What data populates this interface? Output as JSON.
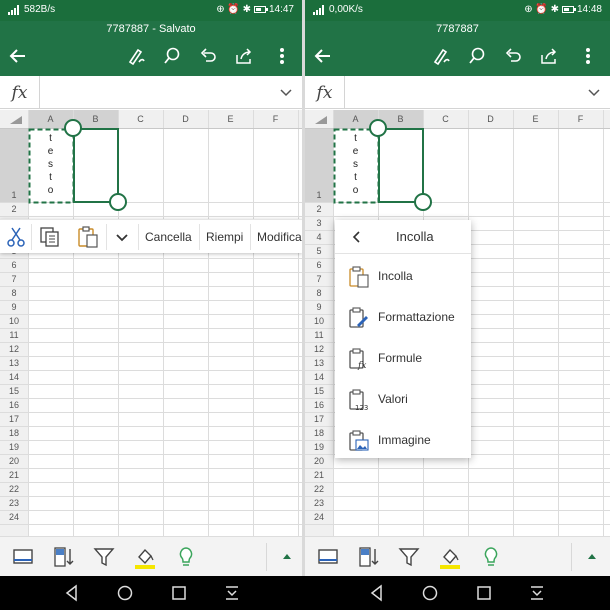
{
  "left": {
    "status": {
      "speed": "582B/s",
      "time": "14:47"
    },
    "title": "7787887 - Salvato",
    "context_toolbar": {
      "cancel_label": "Cancella",
      "fill_label": "Riempi",
      "edit_label": "Modifica"
    }
  },
  "right": {
    "status": {
      "speed": "0,00K/s",
      "time": "14:48"
    },
    "title": "7787887",
    "paste_menu": {
      "title": "Incolla",
      "items": [
        {
          "label": "Incolla",
          "icon": "paste-icon"
        },
        {
          "label": "Formattazione",
          "icon": "paste-formatting-icon"
        },
        {
          "label": "Formule",
          "icon": "paste-formulas-icon"
        },
        {
          "label": "Valori",
          "icon": "paste-values-icon"
        },
        {
          "label": "Immagine",
          "icon": "paste-picture-icon"
        }
      ]
    }
  },
  "formula_bar": {
    "fx_label": "fx"
  },
  "sheet": {
    "columns": [
      "A",
      "B",
      "C",
      "D",
      "E",
      "F"
    ],
    "rows": [
      "1",
      "2",
      "3",
      "4",
      "5",
      "6",
      "7",
      "8",
      "9",
      "10",
      "11",
      "12",
      "13",
      "14",
      "15",
      "16",
      "17",
      "18",
      "19",
      "20",
      "21",
      "22",
      "23",
      "24"
    ],
    "cell_a1": [
      "t",
      "e",
      "s",
      "t",
      "o"
    ]
  },
  "colors": {
    "brand": "#217346",
    "status_bar": "#1b6e3c",
    "highlight": "#f5e600"
  }
}
